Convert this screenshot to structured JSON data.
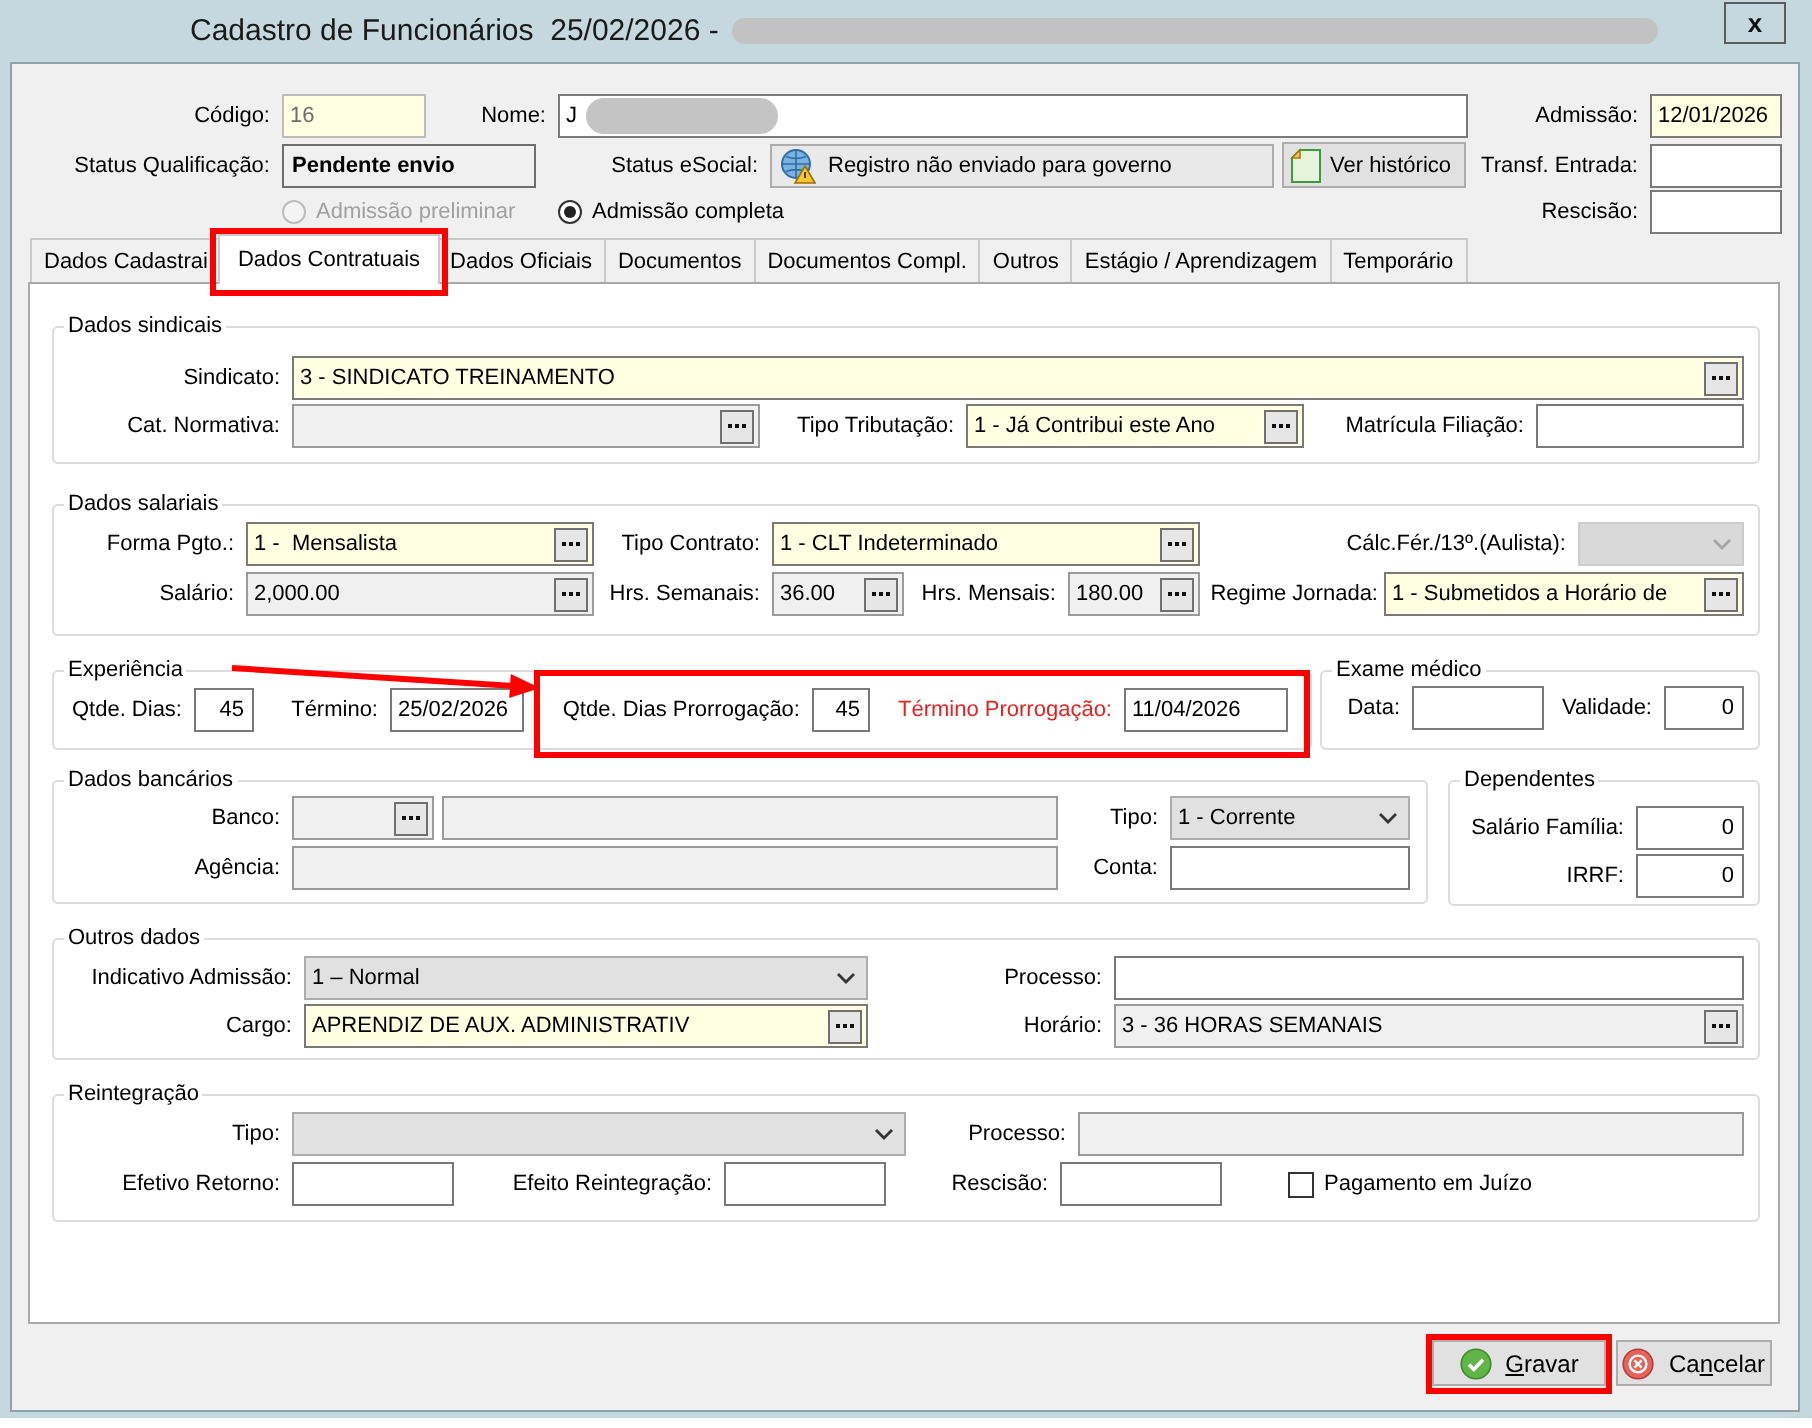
{
  "window": {
    "title": "Cadastro de Funcionários  25/02/2026 -",
    "title_redacted": true,
    "close": "x"
  },
  "header": {
    "rows": [
      {
        "fields": [
          {
            "kind": "text",
            "label": "Código:",
            "value": "16",
            "required": true,
            "readonly": false,
            "disabled": true
          },
          {
            "kind": "text",
            "label": "Nome:",
            "value": "J",
            "redacted": true,
            "required": false,
            "readonly": false,
            "disabled": false
          },
          {
            "kind": "text",
            "label": "Admissão:",
            "value": "12/01/2026",
            "required": true,
            "readonly": false,
            "disabled": false
          }
        ]
      },
      {
        "fields": [
          {
            "kind": "status",
            "label": "Status Qualificação:",
            "value": "Pendente envio"
          },
          {
            "kind": "status_icon",
            "label": "Status eSocial:",
            "value": "Registro não enviado para governo"
          },
          {
            "kind": "button",
            "label": "Ver histórico"
          },
          {
            "kind": "text",
            "label": "Transf. Entrada:",
            "required": false,
            "readonly": false,
            "disabled": false
          }
        ]
      },
      {
        "fields": [
          {
            "kind": "radio",
            "label": "Admissão preliminar",
            "selected": false,
            "disabled": true
          },
          {
            "kind": "radio",
            "label": "Admissão completa",
            "selected": true,
            "disabled": false
          },
          {
            "kind": "text",
            "label": "Rescisão:",
            "required": false,
            "readonly": false,
            "disabled": false
          }
        ]
      }
    ]
  },
  "tabs": [
    {
      "label": "Dados Cadastrai",
      "selected": false,
      "highlighted": false
    },
    {
      "label": "Dados Contratuais",
      "selected": true,
      "highlighted": true
    },
    {
      "label": "Dados Oficiais",
      "selected": false,
      "highlighted": false
    },
    {
      "label": "Documentos",
      "selected": false,
      "highlighted": false
    },
    {
      "label": "Documentos Compl.",
      "selected": false,
      "highlighted": false
    },
    {
      "label": "Outros",
      "selected": false,
      "highlighted": false
    },
    {
      "label": "Estágio / Aprendizagem",
      "selected": false,
      "highlighted": false
    },
    {
      "label": "Temporário",
      "selected": false,
      "highlighted": false
    }
  ],
  "groups": [
    {
      "title": "Dados sindicais",
      "rows": [
        {
          "fields": [
            {
              "kind": "lookup",
              "label": "Sindicato:",
              "value": "3 - SINDICATO TREINAMENTO",
              "required": true,
              "readonly": false,
              "disabled": false
            }
          ]
        },
        {
          "fields": [
            {
              "kind": "lookup",
              "label": "Cat. Normativa:",
              "required": false,
              "readonly": true,
              "disabled": false
            },
            {
              "kind": "lookup",
              "label": "Tipo Tributação:",
              "value": "1 - Já Contribui este Ano",
              "required": true,
              "readonly": false,
              "disabled": false
            },
            {
              "kind": "text",
              "label": "Matrícula Filiação:",
              "required": false,
              "readonly": false,
              "disabled": false
            }
          ]
        }
      ]
    },
    {
      "title": "Dados salariais",
      "rows": [
        {
          "fields": [
            {
              "kind": "lookup",
              "label": "Forma Pgto.:",
              "value": "1 -  Mensalista",
              "required": true,
              "readonly": false,
              "disabled": false
            },
            {
              "kind": "lookup",
              "label": "Tipo Contrato:",
              "value": "1 - CLT Indeterminado",
              "required": true,
              "readonly": false,
              "disabled": false
            },
            {
              "kind": "combo",
              "label": "Cálc.Fér./13º.(Aulista):",
              "required": false,
              "readonly": false,
              "disabled": true
            }
          ]
        },
        {
          "fields": [
            {
              "kind": "lookup",
              "label": "Salário:",
              "value": "2,000.00",
              "required": false,
              "readonly": true,
              "disabled": false
            },
            {
              "kind": "lookup",
              "label": "Hrs. Semanais:",
              "value": "36.00",
              "required": false,
              "readonly": true,
              "disabled": false
            },
            {
              "kind": "lookup",
              "label": "Hrs. Mensais:",
              "value": "180.00",
              "required": false,
              "readonly": true,
              "disabled": false
            },
            {
              "kind": "lookup",
              "label": "Regime Jornada:",
              "value": "1 - Submetidos a Horário de",
              "required": true,
              "readonly": false,
              "disabled": false
            }
          ]
        }
      ]
    },
    {
      "title": "Experiência",
      "pointer_arrow": true,
      "rows": [
        {
          "fields": [
            {
              "kind": "number",
              "label": "Qtde. Dias:",
              "value": "45",
              "required": false,
              "readonly": false,
              "disabled": false
            },
            {
              "kind": "text",
              "label": "Término:",
              "value": "25/02/2026",
              "required": false,
              "readonly": false,
              "disabled": false
            }
          ],
          "extension": {
            "highlighted": true,
            "fields": [
              {
                "kind": "number",
                "label": "Qtde. Dias Prorrogação:",
                "value": "45",
                "required": false,
                "readonly": false,
                "disabled": false
              },
              {
                "kind": "text",
                "label": "Término Prorrogação:",
                "value": "11/04/2026",
                "color": "#e52222",
                "required": false,
                "readonly": false,
                "disabled": false
              }
            ]
          }
        }
      ]
    },
    {
      "title": "Exame médico",
      "rows": [
        {
          "fields": [
            {
              "kind": "text",
              "label": "Data:",
              "required": false,
              "readonly": false,
              "disabled": false
            },
            {
              "kind": "number",
              "label": "Validade:",
              "value": "0",
              "required": false,
              "readonly": false,
              "disabled": false
            }
          ]
        }
      ]
    },
    {
      "title": "Dados bancários",
      "rows": [
        {
          "fields": [
            {
              "kind": "lookup",
              "label": "Banco:",
              "required": false,
              "readonly": true,
              "disabled": false
            },
            {
              "kind": "text",
              "required": false,
              "readonly": true,
              "disabled": false
            },
            {
              "kind": "combo",
              "label": "Tipo:",
              "value": "1 - Corrente",
              "required": false,
              "readonly": false,
              "disabled": false
            }
          ]
        },
        {
          "fields": [
            {
              "kind": "text",
              "label": "Agência:",
              "required": false,
              "readonly": true,
              "disabled": false
            },
            {
              "kind": "text",
              "label": "Conta:",
              "required": false,
              "readonly": false,
              "disabled": false
            }
          ]
        }
      ]
    },
    {
      "title": "Dependentes",
      "rows": [
        {
          "fields": [
            {
              "kind": "number",
              "label": "Salário Família:",
              "value": "0",
              "required": false,
              "readonly": false,
              "disabled": false
            }
          ]
        },
        {
          "fields": [
            {
              "kind": "number",
              "label": "IRRF:",
              "value": "0",
              "required": false,
              "readonly": false,
              "disabled": false
            }
          ]
        }
      ]
    },
    {
      "title": "Outros dados",
      "rows": [
        {
          "fields": [
            {
              "kind": "combo",
              "label": "Indicativo Admissão:",
              "value": "1 – Normal",
              "required": false,
              "readonly": false,
              "disabled": false
            },
            {
              "kind": "text",
              "label": "Processo:",
              "required": false,
              "readonly": false,
              "disabled": false
            }
          ]
        },
        {
          "fields": [
            {
              "kind": "lookup",
              "label": "Cargo:",
              "value": "APRENDIZ DE AUX. ADMINISTRATIV",
              "required": true,
              "readonly": false,
              "disabled": false
            },
            {
              "kind": "lookup",
              "label": "Horário:",
              "value": "3 - 36 HORAS SEMANAIS",
              "required": false,
              "readonly": true,
              "disabled": false
            }
          ]
        }
      ]
    },
    {
      "title": "Reintegração",
      "rows": [
        {
          "fields": [
            {
              "kind": "combo",
              "label": "Tipo:",
              "required": false,
              "readonly": false,
              "disabled": false
            },
            {
              "kind": "text",
              "label": "Processo:",
              "required": false,
              "readonly": true,
              "disabled": false
            }
          ]
        },
        {
          "fields": [
            {
              "kind": "text",
              "label": "Efetivo Retorno:",
              "required": false,
              "readonly": false,
              "disabled": false
            },
            {
              "kind": "text",
              "label": "Efeito Reintegração:",
              "required": false,
              "readonly": false,
              "disabled": false
            },
            {
              "kind": "text",
              "label": "Rescisão:",
              "required": false,
              "readonly": false,
              "disabled": false
            },
            {
              "kind": "check",
              "label": "Pagamento em Juízo",
              "checked": false
            }
          ]
        }
      ]
    }
  ],
  "buttons": [
    {
      "kind": "save",
      "highlighted": true,
      "parts": [
        {
          "text": "G",
          "underline": true
        },
        {
          "text": "ravar",
          "underline": false
        }
      ]
    },
    {
      "kind": "cancel",
      "highlighted": false,
      "parts": [
        {
          "text": "Ca",
          "underline": false
        },
        {
          "text": "n",
          "underline": true
        },
        {
          "text": "celar",
          "underline": false
        }
      ]
    }
  ]
}
